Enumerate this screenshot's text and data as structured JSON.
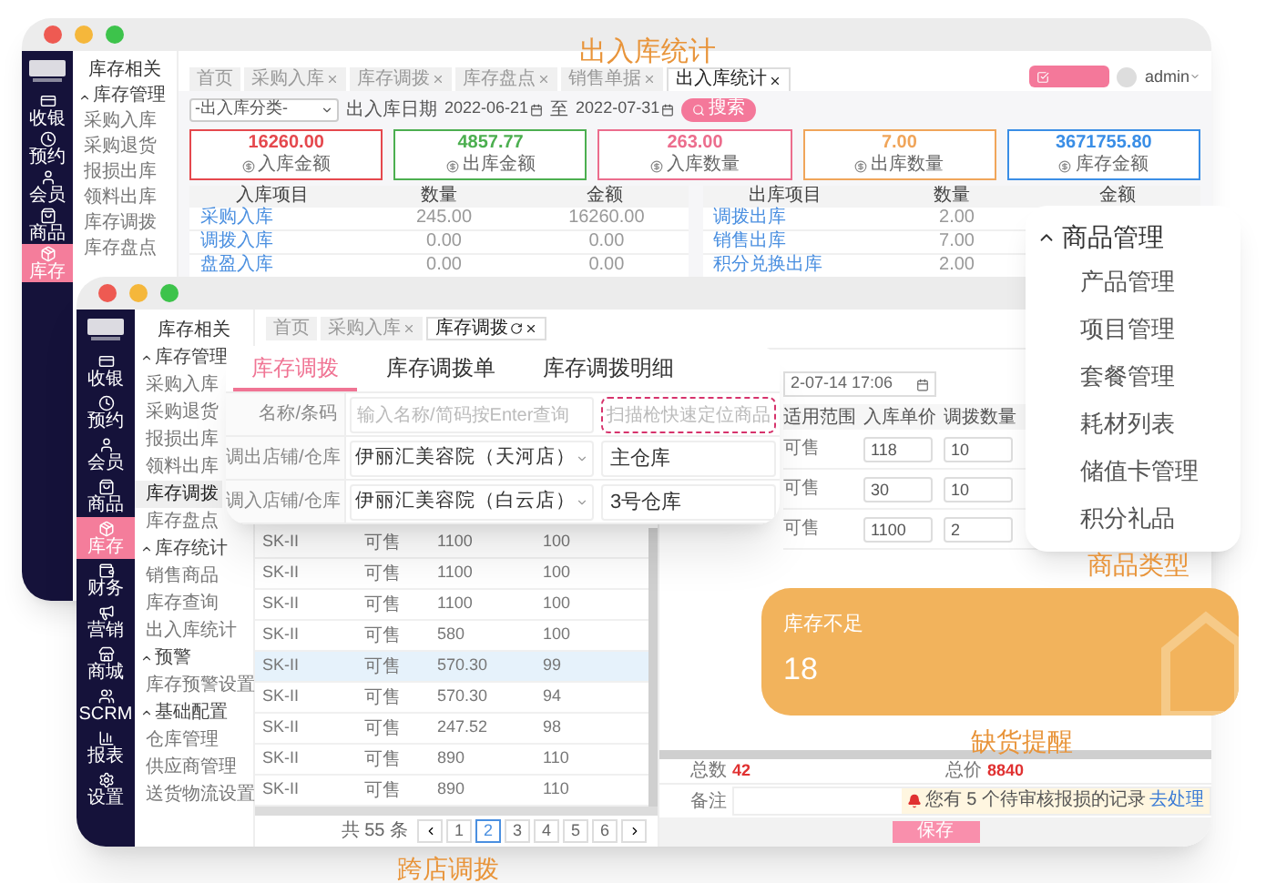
{
  "back_window": {
    "caption": "出入库统计",
    "sidebar": [
      {
        "label": "收银",
        "selected": false
      },
      {
        "label": "预约",
        "selected": false
      },
      {
        "label": "会员",
        "selected": false
      },
      {
        "label": "商品",
        "selected": false
      },
      {
        "label": "库存",
        "selected": true
      }
    ],
    "submenu": {
      "title": "库存相关",
      "groups": [
        {
          "label": "库存管理",
          "expanded": true,
          "children": [
            {
              "label": "采购入库",
              "selected": false
            },
            {
              "label": "采购退货",
              "selected": false
            },
            {
              "label": "报损出库",
              "selected": false
            },
            {
              "label": "领料出库",
              "selected": false
            },
            {
              "label": "库存调拨",
              "selected": false
            },
            {
              "label": "库存盘点",
              "selected": false
            }
          ]
        }
      ]
    },
    "tabs": [
      {
        "label": "首页",
        "selected": false,
        "closable": false
      },
      {
        "label": "采购入库",
        "selected": false,
        "closable": true
      },
      {
        "label": "库存调拨",
        "selected": false,
        "closable": true
      },
      {
        "label": "库存盘点",
        "selected": false,
        "closable": true
      },
      {
        "label": "销售单据",
        "selected": false,
        "closable": true
      },
      {
        "label": "出入库统计",
        "selected": true,
        "closable": true
      }
    ],
    "user": "admin",
    "filter": {
      "category": "-出入库分类-",
      "date_label": "出入库日期",
      "start": "2022-06-21",
      "separator": "至",
      "end": "2022-07-31",
      "search": "搜索"
    },
    "stats": [
      {
        "value": "16260.00",
        "label": "入库金额",
        "color": "#e5484d"
      },
      {
        "value": "4857.77",
        "label": "出库金额",
        "color": "#4caf50"
      },
      {
        "value": "263.00",
        "label": "入库数量",
        "color": "#ec6d8d"
      },
      {
        "value": "7.00",
        "label": "出库数量",
        "color": "#f0a55a"
      },
      {
        "value": "3671755.80",
        "label": "库存金额",
        "color": "#3a8ee6"
      }
    ],
    "tables": [
      {
        "columns": [
          "入库项目",
          "数量",
          "金额"
        ],
        "rows": [
          [
            "采购入库",
            "245.00",
            "16260.00"
          ],
          [
            "调拨入库",
            "0.00",
            "0.00"
          ],
          [
            "盘盈入库",
            "0.00",
            "0.00"
          ]
        ]
      },
      {
        "columns": [
          "出库项目",
          "数量",
          "金额"
        ],
        "rows": [
          [
            "调拨出库",
            "2.00"
          ],
          [
            "销售出库",
            "7.00"
          ],
          [
            "积分兑换出库",
            "2.00"
          ]
        ]
      }
    ]
  },
  "front_window": {
    "caption": "跨店调拨",
    "sidebar": [
      {
        "label": "收银",
        "selected": false
      },
      {
        "label": "预约",
        "selected": false
      },
      {
        "label": "会员",
        "selected": false
      },
      {
        "label": "商品",
        "selected": false
      },
      {
        "label": "库存",
        "selected": true
      },
      {
        "label": "财务",
        "selected": false
      },
      {
        "label": "营销",
        "selected": false
      },
      {
        "label": "商城",
        "selected": false
      },
      {
        "label": "SCRM",
        "selected": false
      },
      {
        "label": "报表",
        "selected": false
      },
      {
        "label": "设置",
        "selected": false
      }
    ],
    "submenu": {
      "title": "库存相关",
      "groups": [
        {
          "label": "库存管理",
          "expanded": true,
          "children": [
            {
              "label": "采购入库",
              "selected": false
            },
            {
              "label": "采购退货",
              "selected": false
            },
            {
              "label": "报损出库",
              "selected": false
            },
            {
              "label": "领料出库",
              "selected": false
            },
            {
              "label": "库存调拨",
              "selected": true
            },
            {
              "label": "库存盘点",
              "selected": false
            }
          ]
        },
        {
          "label": "库存统计",
          "expanded": true,
          "children": [
            {
              "label": "销售商品",
              "selected": false
            },
            {
              "label": "库存查询",
              "selected": false
            },
            {
              "label": "出入库统计",
              "selected": false
            }
          ]
        },
        {
          "label": "预警",
          "expanded": true,
          "children": [
            {
              "label": "库存预警设置",
              "selected": false
            }
          ]
        },
        {
          "label": "基础配置",
          "expanded": true,
          "children": [
            {
              "label": "仓库管理",
              "selected": false
            },
            {
              "label": "供应商管理",
              "selected": false
            },
            {
              "label": "送货物流设置",
              "selected": false
            }
          ]
        }
      ]
    },
    "tabs": [
      {
        "label": "首页",
        "selected": false,
        "closable": false,
        "refresh": false
      },
      {
        "label": "采购入库",
        "selected": false,
        "closable": true,
        "refresh": false
      },
      {
        "label": "库存调拨",
        "selected": true,
        "closable": true,
        "refresh": true
      }
    ],
    "table": {
      "rows": [
        {
          "name": "SK-II",
          "status": "可售",
          "price": "1100",
          "qty": "100",
          "selected": false
        },
        {
          "name": "SK-II",
          "status": "可售",
          "price": "1100",
          "qty": "100",
          "selected": false
        },
        {
          "name": "SK-II",
          "status": "可售",
          "price": "1100",
          "qty": "100",
          "selected": false
        },
        {
          "name": "SK-II",
          "status": "可售",
          "price": "580",
          "qty": "100",
          "selected": false
        },
        {
          "name": "SK-II",
          "status": "可售",
          "price": "570.30",
          "qty": "99",
          "selected": true
        },
        {
          "name": "SK-II",
          "status": "可售",
          "price": "570.30",
          "qty": "94",
          "selected": false
        },
        {
          "name": "SK-II",
          "status": "可售",
          "price": "247.52",
          "qty": "98",
          "selected": false
        },
        {
          "name": "SK-II",
          "status": "可售",
          "price": "890",
          "qty": "110",
          "selected": false
        },
        {
          "name": "SK-II",
          "status": "可售",
          "price": "890",
          "qty": "110",
          "selected": false
        }
      ]
    },
    "pagination": {
      "total": "共 55 条",
      "pages": [
        {
          "label": "1",
          "selected": false
        },
        {
          "label": "2",
          "selected": true
        },
        {
          "label": "3",
          "selected": false
        },
        {
          "label": "4",
          "selected": false
        },
        {
          "label": "5",
          "selected": false
        },
        {
          "label": "6",
          "selected": false
        }
      ]
    },
    "panel": {
      "date": "2-07-14 17:06",
      "columns": [
        "适用范围",
        "入库单价",
        "调拨数量"
      ],
      "rows": [
        {
          "status": "可售",
          "price": "118",
          "qty": "10"
        },
        {
          "status": "可售",
          "price": "30",
          "qty": "10"
        },
        {
          "status": "可售",
          "price": "1100",
          "qty": "2"
        }
      ],
      "total_label": "总数",
      "total": "42",
      "amount_label": "总价",
      "amount": "8840",
      "remark_label": "备注",
      "alert": "您有 5 个待审核报损的记录",
      "alert_link": "去处理",
      "save": "保存"
    }
  },
  "transfer_dialog": {
    "tabs": [
      {
        "label": "库存调拨",
        "selected": true
      },
      {
        "label": "库存调拨单",
        "selected": false
      },
      {
        "label": "库存调拨明细",
        "selected": false
      }
    ],
    "fields": [
      {
        "kind": "search",
        "label": "名称/条码",
        "placeholder": "输入名称/简码按Enter查询",
        "scan_placeholder": "扫描枪快速定位商品"
      },
      {
        "kind": "select",
        "label": "调出店铺/仓库",
        "store": "伊丽汇美容院（天河店）",
        "warehouse": "主仓库"
      },
      {
        "kind": "select",
        "label": "调入店铺/仓库",
        "store": "伊丽汇美容院（白云店）",
        "warehouse": "3号仓库"
      }
    ]
  },
  "category_menu": {
    "group": {
      "label": "商品管理",
      "expanded": true,
      "children": [
        "产品管理",
        "项目管理",
        "套餐管理",
        "耗材列表",
        "储值卡管理",
        "积分礼品"
      ]
    },
    "caption": "商品类型"
  },
  "shortage_card": {
    "label": "库存不足",
    "value": "18",
    "caption": "缺货提醒"
  }
}
